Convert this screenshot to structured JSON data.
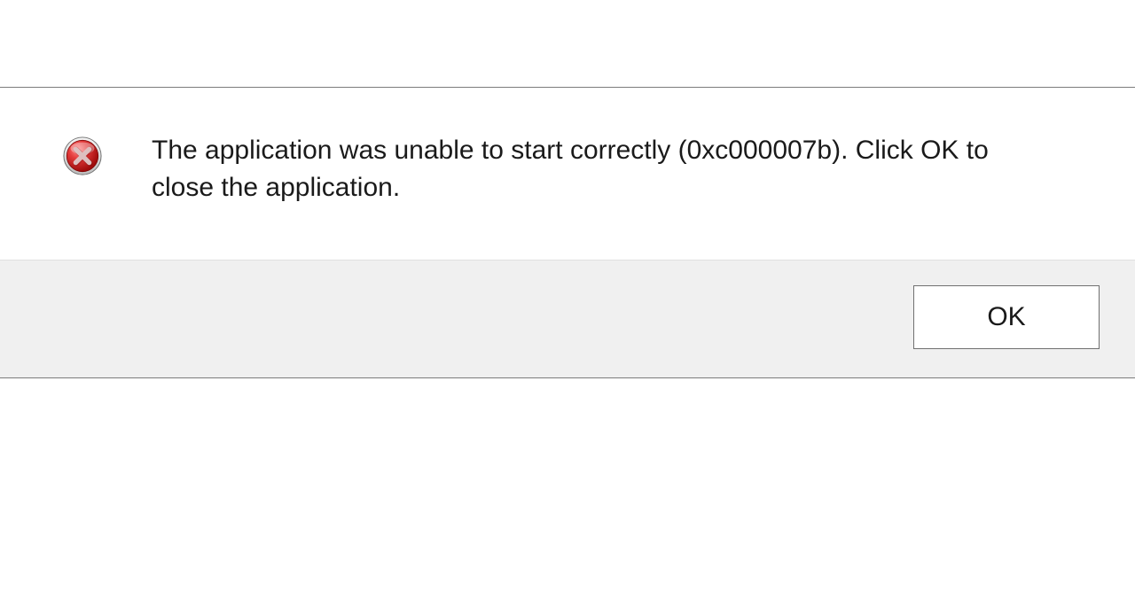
{
  "dialog": {
    "message": "The application was unable to start correctly (0xc000007b). Click OK to close the application.",
    "ok_label": "OK",
    "icon": "error-x-icon"
  }
}
